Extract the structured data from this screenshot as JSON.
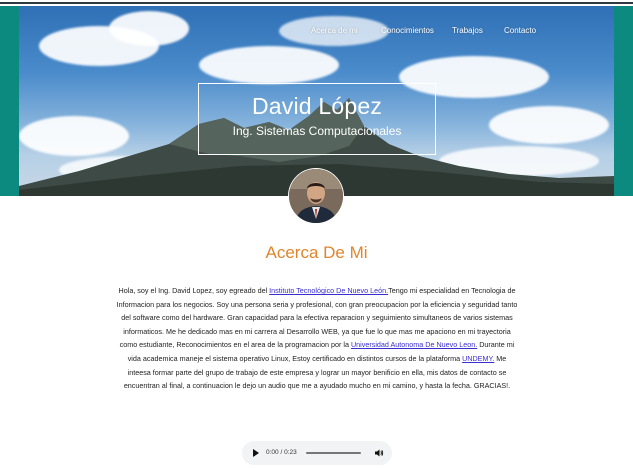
{
  "nav": {
    "items": [
      "Acerca de mi",
      "Conocimientos",
      "Trabajos",
      "Contacto"
    ]
  },
  "hero": {
    "name": "David López",
    "subtitle": "Ing. Sistemas Computacionales"
  },
  "about": {
    "heading": "Acerca De Mi",
    "p1": "Hola, soy el Ing. David Lopez, soy egreado del ",
    "link1": "Instituto Tecnológico De Nuevo León.",
    "p2": "Tengo mi especialidad en Tecnologia de Informacion para los negocios. Soy una persona seria y profesional, con gran preocupacion por la eficiencia y seguridad tanto del software como del hardware. Gran capacidad para la efectiva reparacion y seguimiento simultaneos de varios sistemas informaticos. Me he dedicado mas en mi carrera al Desarrollo WEB, ya que fue lo que mas me apaciono en mi trayectoria como estudiante, Reconocimientos en el area de la programacion por la ",
    "link2": "Universidad Autonoma De Nuevo Leon.",
    "p3": " Durante mi vida academica maneje el sistema operativo Linux, Estoy certificado en distintos cursos de la plataforma ",
    "link3": "UNDEMY.",
    "p4": " Me inteesa formar parte del grupo de trabajo de este empresa y lograr un mayor benificio en ella, mis datos de contacto se encuentran al final, a continuacion le dejo un audio que me a ayudado mucho en mi camino, y hasta la fecha. GRACIAS!."
  },
  "audio": {
    "time": "0:00 / 0:23",
    "progress": 0,
    "play_icon": "play-icon",
    "volume_icon": "volume-icon"
  },
  "colors": {
    "teal": "#0d8a80",
    "heading": "#e0852b",
    "link": "#3a2ed0"
  }
}
